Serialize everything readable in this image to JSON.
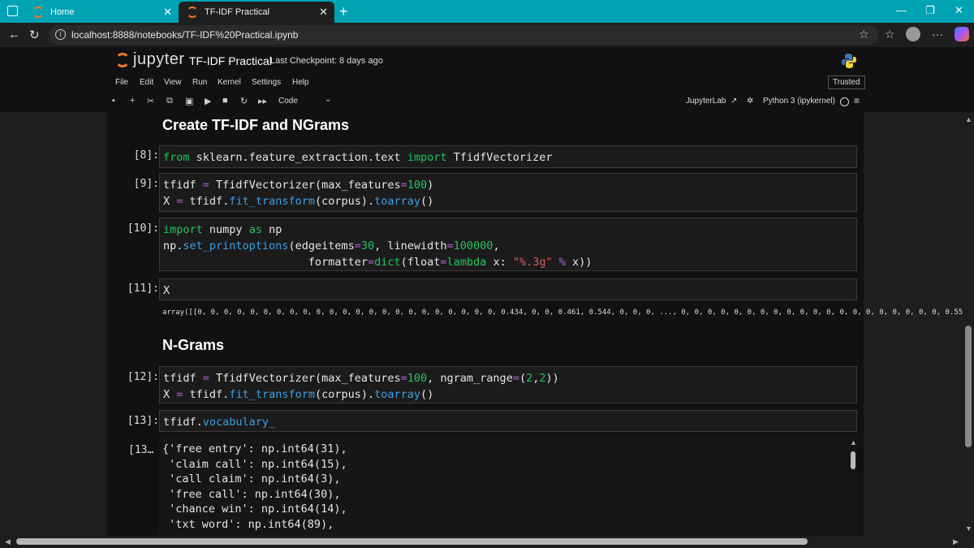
{
  "browser": {
    "tabs": [
      {
        "label": "Home"
      },
      {
        "label": "TF-IDF Practical"
      }
    ],
    "url": "localhost:8888/notebooks/TF-IDF%20Practical.ipynb"
  },
  "jupyter": {
    "logo_text": "jupyter",
    "notebook_title": "TF-IDF Practical",
    "checkpoint": "Last Checkpoint: 8 days ago",
    "menu": [
      "File",
      "Edit",
      "View",
      "Run",
      "Kernel",
      "Settings",
      "Help"
    ],
    "trusted": "Trusted",
    "cell_type": "Code",
    "jupyterlab_link": "JupyterLab",
    "kernel": "Python 3 (ipykernel)"
  },
  "notebook": {
    "heading1": "Create TF-IDF and NGrams",
    "heading2": "N-Grams",
    "prompts": [
      "[8]:",
      "[9]:",
      "[10]:",
      "[11]:",
      "[12]:",
      "[13]:",
      "[13…"
    ],
    "out11": "array([[0, 0, 0, 0, 0, 0, 0, 0, 0, 0, 0, 0, 0, 0, 0, 0, 0, 0, 0, 0, 0, 0, 0, 0.434, 0, 0, 0.461, 0.544, 0, 0, 0, ..., 0, 0, 0, 0, 0, 0, 0, 0, 0, 0, 0, 0, 0, 0, 0, 0, 0, 0, 0, 0, 0.55",
    "vocab": [
      "{'free entry': np.int64(31),",
      " 'claim call': np.int64(15),",
      " 'call claim': np.int64(3),",
      " 'free call': np.int64(30),",
      " 'chance win': np.int64(14),",
      " 'txt word': np.int64(89),"
    ]
  }
}
